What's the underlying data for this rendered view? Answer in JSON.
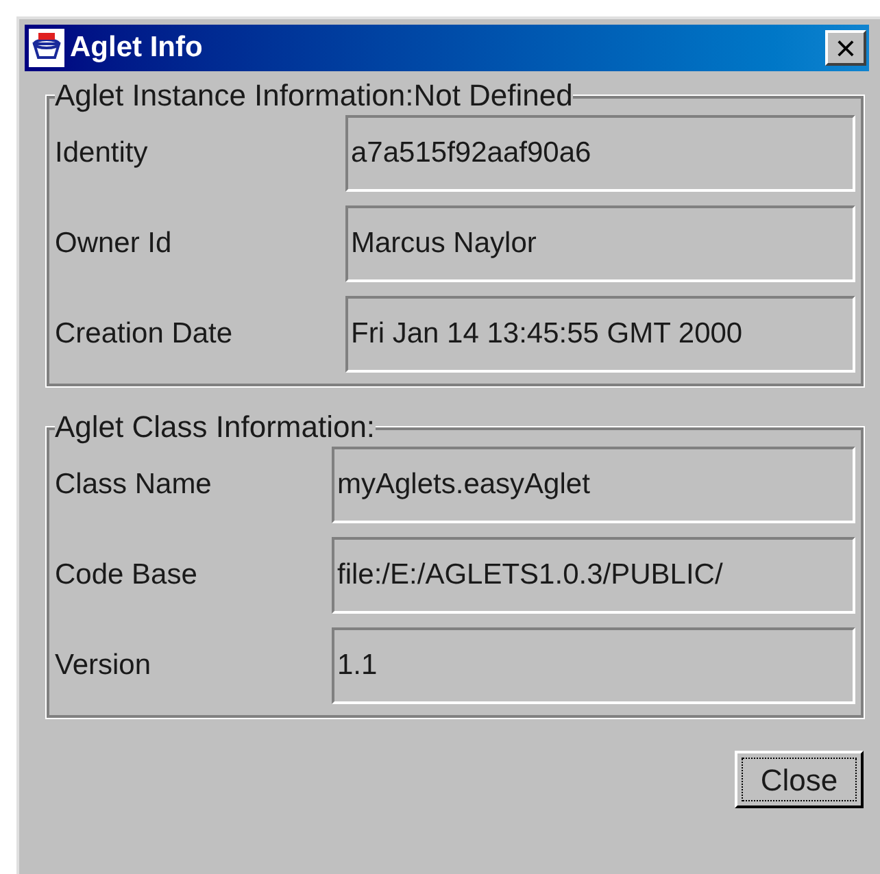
{
  "window": {
    "title": "Aglet Info",
    "close": "×"
  },
  "groups": [
    {
      "title": "Aglet Instance Information:Not Defined",
      "rows": [
        {
          "label": "Identity",
          "value": "a7a515f92aaf90a6"
        },
        {
          "label": "Owner Id",
          "value": "Marcus Naylor"
        },
        {
          "label": "Creation Date",
          "value": "Fri Jan 14 13:45:55 GMT 2000"
        }
      ]
    },
    {
      "title": "Aglet Class Information:",
      "rows": [
        {
          "label": "Class Name",
          "value": "myAglets.easyAglet"
        },
        {
          "label": "Code Base",
          "value": "file:/E:/AGLETS1.0.3/PUBLIC/"
        },
        {
          "label": "Version",
          "value": "1.1"
        }
      ]
    }
  ],
  "buttons": [
    {
      "label": "Close",
      "focused": true
    }
  ]
}
